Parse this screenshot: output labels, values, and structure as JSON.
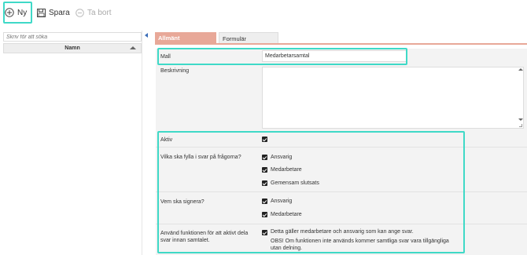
{
  "toolbar": {
    "new_label": "Ny",
    "save_label": "Spara",
    "delete_label": "Ta bort"
  },
  "sidebar": {
    "search_placeholder": "Skriv för att söka",
    "column_header": "Namn"
  },
  "tabs": [
    {
      "label": "Allmänt",
      "active": true
    },
    {
      "label": "Formulär",
      "active": false
    }
  ],
  "form": {
    "template_label": "Mall",
    "template_value": "Medarbetarsamtal",
    "description_label": "Beskrivning",
    "description_value": "",
    "active_label": "Aktiv",
    "active_checked": true,
    "fill_label": "Vilka ska fylla i svar på frågorna?",
    "fill_options": [
      {
        "label": "Ansvarig",
        "checked": true
      },
      {
        "label": "Medarbetare",
        "checked": true
      },
      {
        "label": "Gemensam slutsats",
        "checked": true
      }
    ],
    "sign_label": "Vem ska signera?",
    "sign_options": [
      {
        "label": "Ansvarig",
        "checked": true
      },
      {
        "label": "Medarbetare",
        "checked": true
      }
    ],
    "require_label": "Använd funktionen för att aktivt dela svar innan samtalet.",
    "require_checked": true,
    "require_text": "Detta gäller medarbetare och ansvarig som kan ange svar.",
    "require_note": "OBS! Om funktionen inte används kommer samtliga svar vara tillgängliga utan delning."
  },
  "colors": {
    "highlight": "#3fd9c7",
    "tab_active": "#e8a898",
    "accent_blue": "#3b6db8"
  }
}
